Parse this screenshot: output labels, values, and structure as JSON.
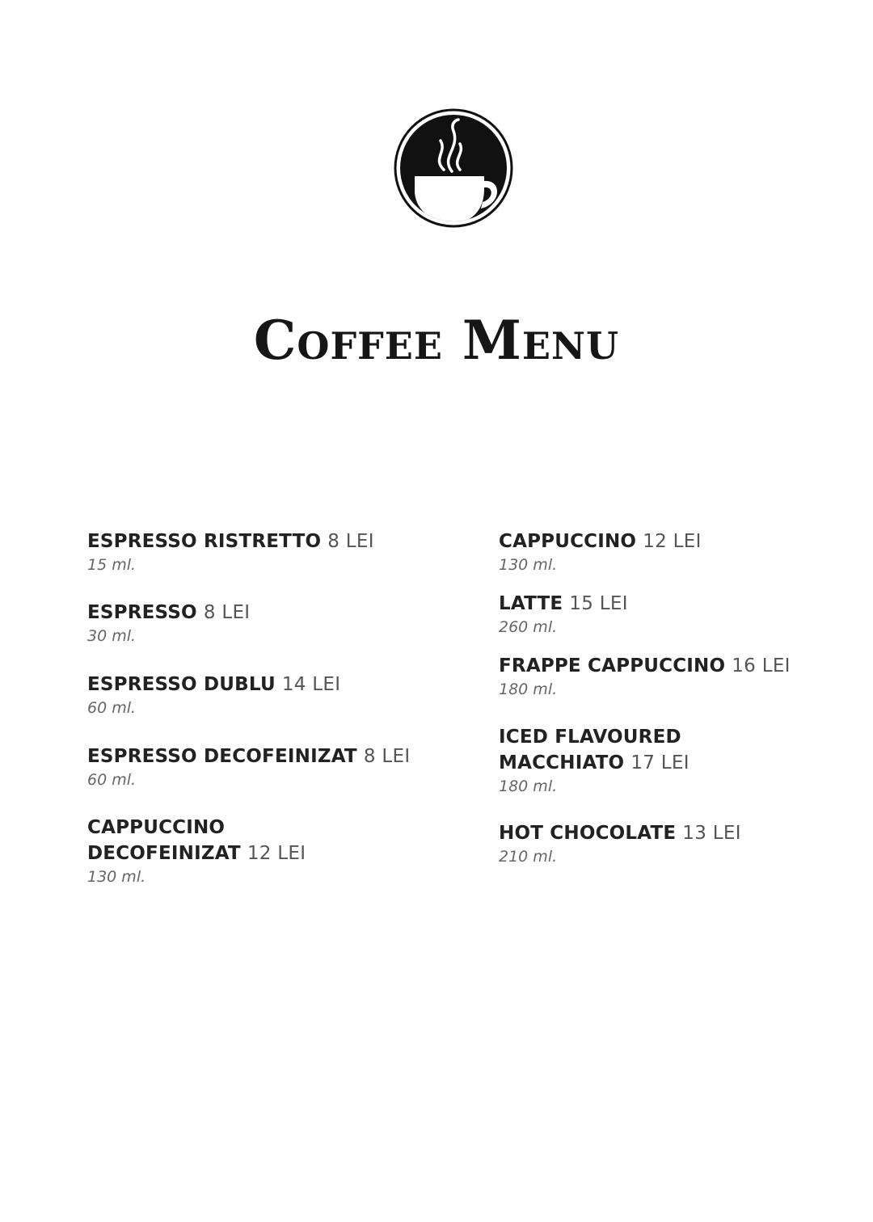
{
  "logo": {
    "icon": "coffee-cup-icon"
  },
  "title": "Coffee Menu",
  "menu": {
    "left": [
      {
        "name": "ESPRESSO RISTRETTO",
        "price": "8 LEI",
        "size": "15 ml."
      },
      {
        "name": "ESPRESSO",
        "price": "8 LEI",
        "size": "30 ml."
      },
      {
        "name": "ESPRESSO DUBLU",
        "price": "14 LEI",
        "size": "60 ml."
      },
      {
        "name": "ESPRESSO DECOFEINIZAT",
        "price": "8 LEI",
        "size": "60 ml."
      },
      {
        "name_line1": "CAPPUCCINO",
        "name": "DECOFEINIZAT",
        "price": "12 LEI",
        "size": "130 ml."
      }
    ],
    "right": [
      {
        "name": "CAPPUCCINO",
        "price": "12 LEI",
        "size": "130 ml."
      },
      {
        "name": "LATTE",
        "price": "15 LEI",
        "size": "260 ml."
      },
      {
        "name": "FRAPPE CAPPUCCINO",
        "price": "16 LEI",
        "size": "180 ml."
      },
      {
        "name_line1": "ICED FLAVOURED",
        "name": "MACCHIATO",
        "price": "17 LEI",
        "size": "180 ml."
      },
      {
        "name": "HOT CHOCOLATE",
        "price": "13 LEI",
        "size": "210 ml."
      }
    ]
  }
}
